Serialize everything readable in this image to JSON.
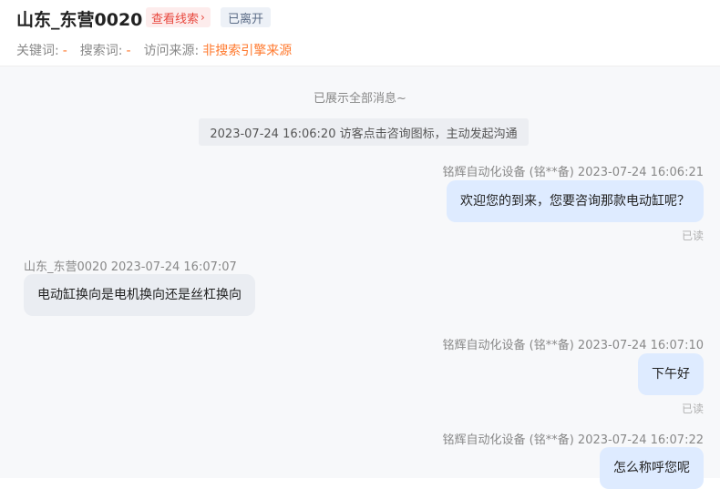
{
  "header": {
    "title": "山东_东营0020",
    "lead_link": "查看线索",
    "status": "已离开",
    "meta": [
      {
        "label": "关键词:",
        "value": "-"
      },
      {
        "label": "搜索词:",
        "value": "-"
      },
      {
        "label": "访问来源:",
        "value": "非搜索引擎来源"
      }
    ]
  },
  "chat": {
    "all_shown": "已展示全部消息~",
    "system_event": "2023-07-24 16:06:20 访客点击咨询图标，主动发起沟通",
    "messages": [
      {
        "sender": "铭辉自动化设备 (铭**备) 2023-07-24 16:06:21",
        "text": "欢迎您的到来，您要咨询那款电动缸呢？",
        "read": "已读"
      },
      {
        "sender": "山东_东营0020 2023-07-24 16:07:07",
        "text": "电动缸换向是电机换向还是丝杠换向"
      },
      {
        "sender": "铭辉自动化设备 (铭**备) 2023-07-24 16:07:10",
        "text": "下午好",
        "read": "已读"
      },
      {
        "sender": "铭辉自动化设备 (铭**备) 2023-07-24 16:07:22",
        "text": "怎么称呼您呢"
      }
    ]
  },
  "colors": {
    "accent_orange": "#ff7a2f",
    "lead_red": "#e8483e",
    "bubble_out": "#deebff",
    "bubble_in": "#eaedf2"
  }
}
